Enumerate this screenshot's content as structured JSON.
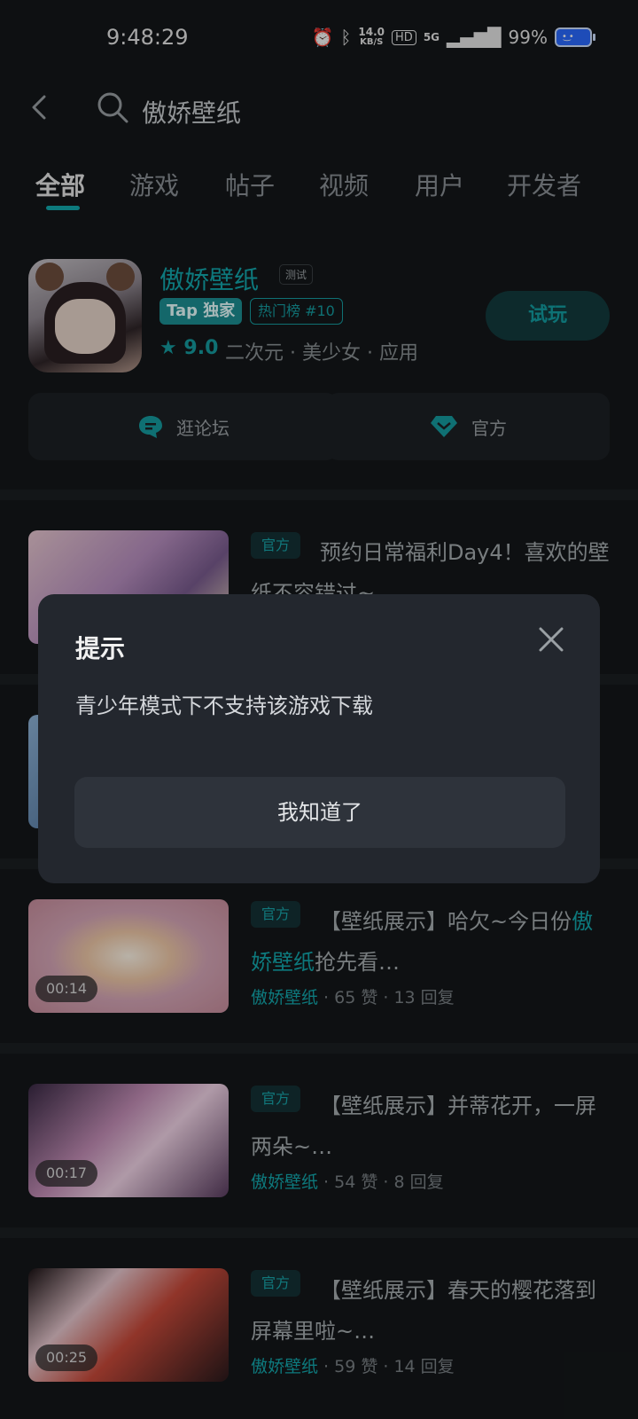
{
  "status_bar": {
    "time": "9:48:29",
    "net_speed_value": "14.0",
    "net_speed_unit": "KB/S",
    "hd_label": "HD",
    "network_label": "5G",
    "battery_percent": "99%"
  },
  "top_bar": {
    "search_text": "傲娇壁纸"
  },
  "tabs": [
    "全部",
    "游戏",
    "帖子",
    "视频",
    "用户",
    "开发者"
  ],
  "app": {
    "name": "傲娇壁纸",
    "test_tag": "测试",
    "tap_badge": "Tap 独家",
    "rank_badge": "热门榜 #10",
    "rating": "9.0",
    "tags": "二次元 · 美少女 · 应用",
    "try_button": "试玩",
    "forum_button": "逛论坛",
    "official_button": "官方"
  },
  "posts": [
    {
      "official_label": "官方",
      "title_prefix": "",
      "title_highlight": "",
      "title_rest": "预约日常福利Day4！喜欢的壁纸不容错过~…",
      "author": "",
      "stats": "",
      "duration": ""
    },
    {
      "official_label": "官方",
      "title_prefix": "【壁纸展示】哈欠~今日份",
      "title_highlight": "傲娇壁纸",
      "title_rest": "抢先看…",
      "author": "傲娇壁纸",
      "stats": " · 65 赞 · 13 回复",
      "duration": "00:14"
    },
    {
      "official_label": "官方",
      "title_prefix": "【壁纸展示】并蒂花开，一屏两朵~…",
      "title_highlight": "",
      "title_rest": "",
      "author": "傲娇壁纸",
      "stats": " · 54 赞 · 8 回复",
      "duration": "00:17"
    },
    {
      "official_label": "官方",
      "title_prefix": "【壁纸展示】春天的樱花落到屏幕里啦~…",
      "title_highlight": "",
      "title_rest": "",
      "author": "傲娇壁纸",
      "stats": " · 59 赞 · 14 回复",
      "duration": "00:25"
    }
  ],
  "dialog": {
    "title": "提示",
    "message": "青少年模式下不支持该游戏下载",
    "confirm_button": "我知道了"
  },
  "colors": {
    "accent": "#13a8ad",
    "background": "#141719",
    "dialog_bg": "#23272e"
  }
}
